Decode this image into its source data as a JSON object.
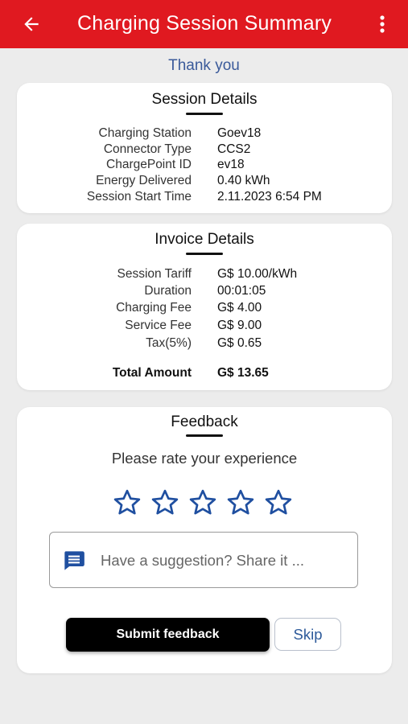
{
  "header": {
    "title": "Charging Session Summary",
    "back_icon": "arrow-left",
    "menu_icon": "more-vertical",
    "background_color": "#e01920"
  },
  "thank_you": "Thank you",
  "session_details": {
    "title": "Session Details",
    "rows": [
      {
        "label": "Charging Station",
        "value": "Goev18"
      },
      {
        "label": "Connector Type",
        "value": "CCS2"
      },
      {
        "label": "ChargePoint ID",
        "value": "ev18"
      },
      {
        "label": "Energy Delivered",
        "value": "0.40 kWh"
      },
      {
        "label": "Session Start Time",
        "value": "2.11.2023 6:54 PM"
      }
    ]
  },
  "invoice_details": {
    "title": "Invoice Details",
    "rows": [
      {
        "label": "Session Tariff",
        "value": "G$ 10.00/kWh"
      },
      {
        "label": "Duration",
        "value": "00:01:05"
      },
      {
        "label": "Charging Fee",
        "value": "G$ 4.00"
      },
      {
        "label": "Service Fee",
        "value": "G$ 9.00"
      },
      {
        "label": "Tax(5%)",
        "value": "G$ 0.65"
      }
    ],
    "total": {
      "label": "Total Amount",
      "value": "G$ 13.65"
    }
  },
  "feedback": {
    "title": "Feedback",
    "prompt": "Please rate your experience",
    "rating": 0,
    "max_rating": 5,
    "star_color": "#1f4fa0",
    "suggestion_placeholder": "Have a suggestion? Share it ...",
    "chat_icon": "chat-bubble",
    "chat_icon_color": "#1f4fa0",
    "submit_label": "Submit feedback",
    "skip_label": "Skip"
  }
}
